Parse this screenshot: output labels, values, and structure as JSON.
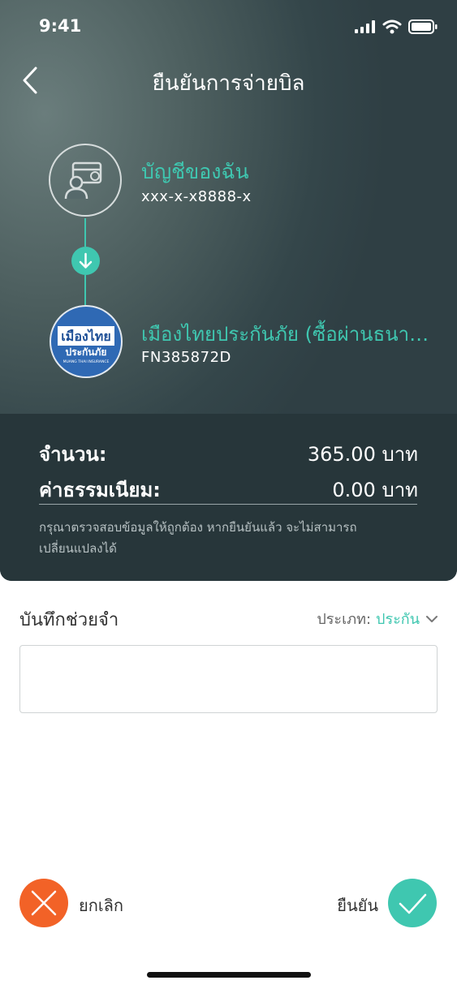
{
  "status_bar": {
    "time": "9:41"
  },
  "header": {
    "title": "ยืนยันการจ่ายบิล"
  },
  "from_account": {
    "name": "บัญชีของฉัน",
    "number": "xxx-x-x8888-x"
  },
  "biller": {
    "name": "เมืองไทยประกันภัย (ซื้อผ่านธนาคาร)",
    "reference": "FN385872D",
    "logo_line1": "เมืองไทย",
    "logo_line2": "ประกันภัย",
    "logo_line3": "MUANG THAI INSURANCE"
  },
  "summary": {
    "amount_label": "จำนวน:",
    "amount_value": "365.00 บาท",
    "fee_label": "ค่าธรรมเนียม:",
    "fee_value": "0.00 บาท",
    "note": "กรุณาตรวจสอบข้อมูลให้ถูกต้อง หากยืนยันแล้ว จะไม่สามารถเปลี่ยนแปลงได้"
  },
  "memo": {
    "label": "บันทึกช่วยจำ",
    "type_label": "ประเภท:",
    "type_value": "ประกัน",
    "value": ""
  },
  "actions": {
    "cancel": "ยกเลิก",
    "confirm": "ยืนยัน"
  },
  "colors": {
    "accent": "#3fc7b0",
    "cancel": "#f26227",
    "header_dark": "#27363a"
  }
}
